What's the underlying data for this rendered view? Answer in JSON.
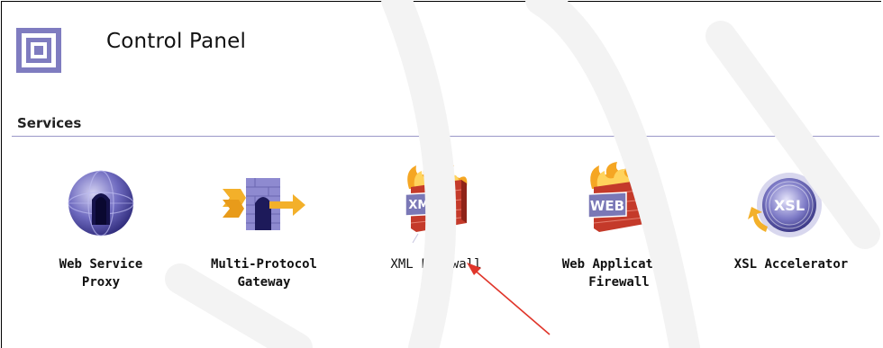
{
  "header": {
    "title": "Control Panel",
    "icon": "control-panel-icon"
  },
  "section": {
    "title": "Services"
  },
  "services": [
    {
      "line1": "Web Service",
      "line2": "Proxy",
      "icon": "globe-icon"
    },
    {
      "line1": "Multi-Protocol",
      "line2": "Gateway",
      "icon": "gateway-icon"
    },
    {
      "line1": "XML Firewall",
      "line2": "",
      "icon": "xml-firewall-icon",
      "badge": "XML"
    },
    {
      "line1": "Web Application",
      "line2": "Firewall",
      "icon": "web-firewall-icon",
      "badge": "WEB"
    },
    {
      "line1": "XSL Accelerator",
      "line2": "",
      "icon": "xsl-accelerator-icon",
      "badge": "XSL"
    }
  ],
  "colors": {
    "rule": "#9a98c8",
    "accent_orange": "#f0a020",
    "firewall_red": "#c43a2a",
    "icon_purple": "#6b67b8"
  }
}
